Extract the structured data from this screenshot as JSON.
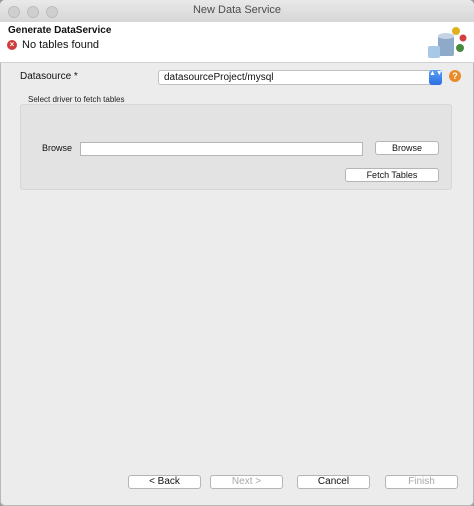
{
  "window": {
    "title": "New Data Service"
  },
  "header": {
    "title": "Generate DataService",
    "message": "No tables found",
    "error_glyph": "×"
  },
  "form": {
    "datasource_label": "Datasource *",
    "datasource_value": "datasourceProject/mysql",
    "select_arrows": "▲▼",
    "help_glyph": "?",
    "group_label": "Select driver to fetch tables",
    "browse_label": "Browse",
    "browse_value": "",
    "browse_button": "Browse",
    "fetch_button": "Fetch Tables"
  },
  "footer": {
    "back": "< Back",
    "next": "Next >",
    "cancel": "Cancel",
    "finish": "Finish"
  },
  "colors": {
    "error": "#d23b3b",
    "help": "#e98b2a",
    "select_accent": "#2b6fe0",
    "disabled_text": "#a8a8a8"
  },
  "icons": {
    "header_logo": "data-service-wizard-icon",
    "error": "error-icon",
    "help": "help-icon"
  }
}
